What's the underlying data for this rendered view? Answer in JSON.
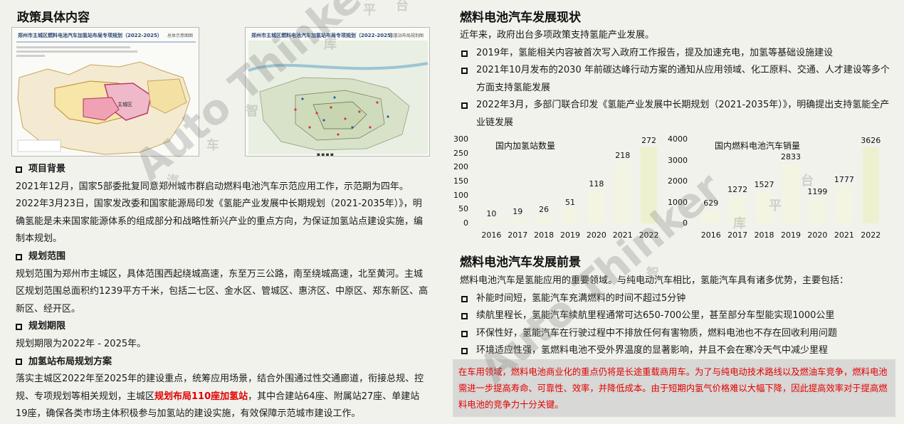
{
  "left": {
    "title": "政策具体内容",
    "map1": {
      "title": "郑州市主城区燃料电池汽车加氢站布局专项规划（2022-2025）",
      "tag": "总体示意图图"
    },
    "map2": {
      "title": "郑州市主城区燃料电池汽车加氢站布局专项规划（2022-2025）",
      "tag": "加氢站布局规划图"
    },
    "s1_title": "项目背景",
    "s1_p1": "2021年12月，国家5部委批复同意郑州城市群启动燃料电池汽车示范应用工作，示范期为四年。",
    "s1_p2": "2022年3月23日，国家发改委和国家能源局印发《氢能产业发展中长期规划（2021-2035年）》，明确氢能是未来国家能源体系的组成部分和战略性新兴产业的重点方向，为保证加氢站点建设实施，编制本规划。",
    "s2_title": "规划范围",
    "s2_p1": "规划范围为郑州市主城区，具体范围西起绕城高速，东至万三公路，南至绕城高速，北至黄河。主城区规划范围总面积约1239平方千米，包括二七区、金水区、管城区、惠济区、中原区、郑东新区、高新区、经开区。",
    "s3_title": "规划期限",
    "s3_p1": "规划期限为2022年 - 2025年。",
    "s4_title": "加氢站布局规划方案",
    "s4_p1a": "落实主城区2022年至2025年的建设重点，统筹应用场景，结合外围通过性交通廊道，衔接总规、控规、专项规划等相关规划，主城区",
    "s4_p1b": "规划布局110座加氢站",
    "s4_p1c": "，其中合建站64座、附属站27座、单建站19座，确保各类市场主体积极参与加氢站的建设实施，有效保障示范城市建设工作。"
  },
  "right": {
    "title1": "燃料电池汽车发展现状",
    "intro": "近年来，政府出台多项政策支持氢能产业发展。",
    "status_items": [
      "2019年，氢能相关内容被首次写入政府工作报告，提及加速充电，加氢等基础设施建设",
      "2021年10月发布的2030 年前碳达峰行动方案的通知从应用领域、化工原料、交通、人才建设等多个方面支持氢能发展",
      "2022年3月，多部门联合印发《氢能产业发展中长期规划（2021-2035年）》，明确提出支持氢能全产业链发展"
    ],
    "title2": "燃料电池汽车发展前景",
    "prospect_intro": "燃料电池汽车是氢能应用的重要领域。与纯电动汽车相比，氢能汽车具有诸多优势，主要包括：",
    "prospect_items": [
      "补能时间短，氢能汽车充满燃料的时间不超过5分钟",
      "续航里程长，氢能汽车续航里程通常可达650-700公里，甚至部分车型能实现1000公里",
      "环保性好，氢能汽车在行驶过程中不排放任何有害物质，燃料电池也不存在回收利用问题",
      "环境适应性强，氢燃料电池不受外界温度的显著影响，并且不会在寒冷天气中减少里程"
    ],
    "callout": "在车用领域，燃料电池商业化的重点仍将是长途重载商用车。为了与纯电动技术路线以及燃油车竞争，燃料电池需进一步提高寿命、可靠性、效率，并降低成本。由于短期内氢气价格难以大幅下降，因此提高效率对于提高燃料电池的竞争力十分关键。"
  },
  "watermark": {
    "text": "Auto Thinker",
    "cn": [
      "汽",
      "车",
      "智",
      "库",
      "平",
      "台"
    ]
  },
  "chart_data": [
    {
      "type": "bar",
      "title": "国内加氢站数量",
      "categories": [
        "2016",
        "2017",
        "2018",
        "2019",
        "2020",
        "2021",
        "2022"
      ],
      "values": [
        10,
        19,
        26,
        51,
        118,
        218,
        272
      ],
      "value_labels": [
        "10",
        "19",
        "26",
        "51",
        "118",
        "218",
        "272"
      ],
      "yticks": [
        "0",
        "50",
        "100",
        "150",
        "200",
        "250",
        "300"
      ],
      "ylim": [
        0,
        300
      ],
      "grid": false,
      "bar_color": "#f3f5e2"
    },
    {
      "type": "bar",
      "title": "国内燃料电池汽车销量",
      "categories": [
        "2016",
        "2017",
        "2018",
        "2019",
        "2020",
        "2021",
        "2022"
      ],
      "values": [
        629,
        1272,
        1527,
        2833,
        1199,
        1777,
        3626
      ],
      "value_labels": [
        "629",
        "1272",
        "1527",
        "2833",
        "1199",
        "1777",
        "3626"
      ],
      "yticks": [
        "0",
        "1000",
        "2000",
        "3000",
        "4000"
      ],
      "ylim": [
        0,
        4000
      ],
      "grid": false,
      "bar_color": "#f3f5e2"
    }
  ]
}
